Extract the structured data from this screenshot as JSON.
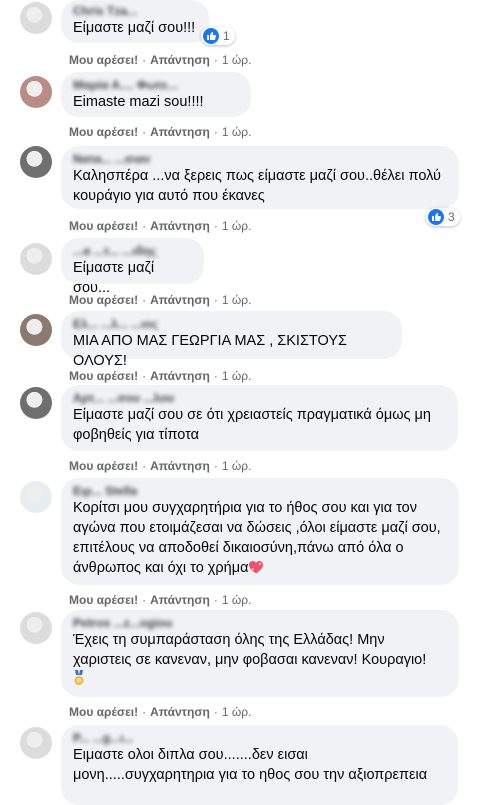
{
  "labels": {
    "like": "Μου αρέσει!",
    "reply": "Απάντηση",
    "sep": "·",
    "time": "1 ώρ."
  },
  "comments": [
    {
      "name": "Chris Tza...",
      "text": "Είμαστε μαζί σου!!!",
      "reactions": "1"
    },
    {
      "name": "Μαρία Α.... Φωτε...",
      "text": "Eimaste mazi sou!!!!",
      "reactions": ""
    },
    {
      "name": "Νατα... ...σιαν",
      "text": "Καλησπέρα ...να ξερεις πως είμαστε μαζί σου..θέλει πολύ κουράγιο για αυτό που έκανες",
      "reactions": "3"
    },
    {
      "name": "...α ...τ... ...ιδης",
      "text": "Είμαστε μαζί σου...",
      "reactions": ""
    },
    {
      "name": "Ελ... ...λ... ...ιος",
      "text": "ΜΙΑ ΑΠΟ ΜΑΣ ΓΕΩΡΓΙΑ ΜΑΣ , ΣΚΙΣΤΟΥΣ ΟΛΟΥΣ!",
      "reactions": ""
    },
    {
      "name": "Αρτ... ...σου ...λου",
      "text": "Είμαστε μαζί σου σε ότι χρειαστείς πραγματικά όμως μη φοβηθείς για τίποτα",
      "reactions": ""
    },
    {
      "name": "Ειρ... Stella",
      "text": "Κορίτσι μου συγχαρητήρια για το ήθος σου και για τον αγώνα που ετοιμάζεσαι να δώσεις ,όλοι είμαστε μαζί σου, επιτέλους να αποδοθεί δικαιοσύνη,πάνω από όλα ο άνθρωπος και όχι το χρήμα",
      "reactions": ""
    },
    {
      "name": "Petros ...z...ogiou",
      "text": "Έχεις τη συμπαράσταση όλης της Ελλάδας! Μην χαριστεις σε κανεναν, μην φοβασαι κανεναν! Κουραγιο!",
      "reactions": ""
    },
    {
      "name": "Ρ... ...g...ι...",
      "text": "Ειμαστε ολοι διπλα σου.......δεν εισαι μονη.....συγχαρητηρια για το ηθος σου την αξιοπρεπεια",
      "reactions": ""
    }
  ]
}
